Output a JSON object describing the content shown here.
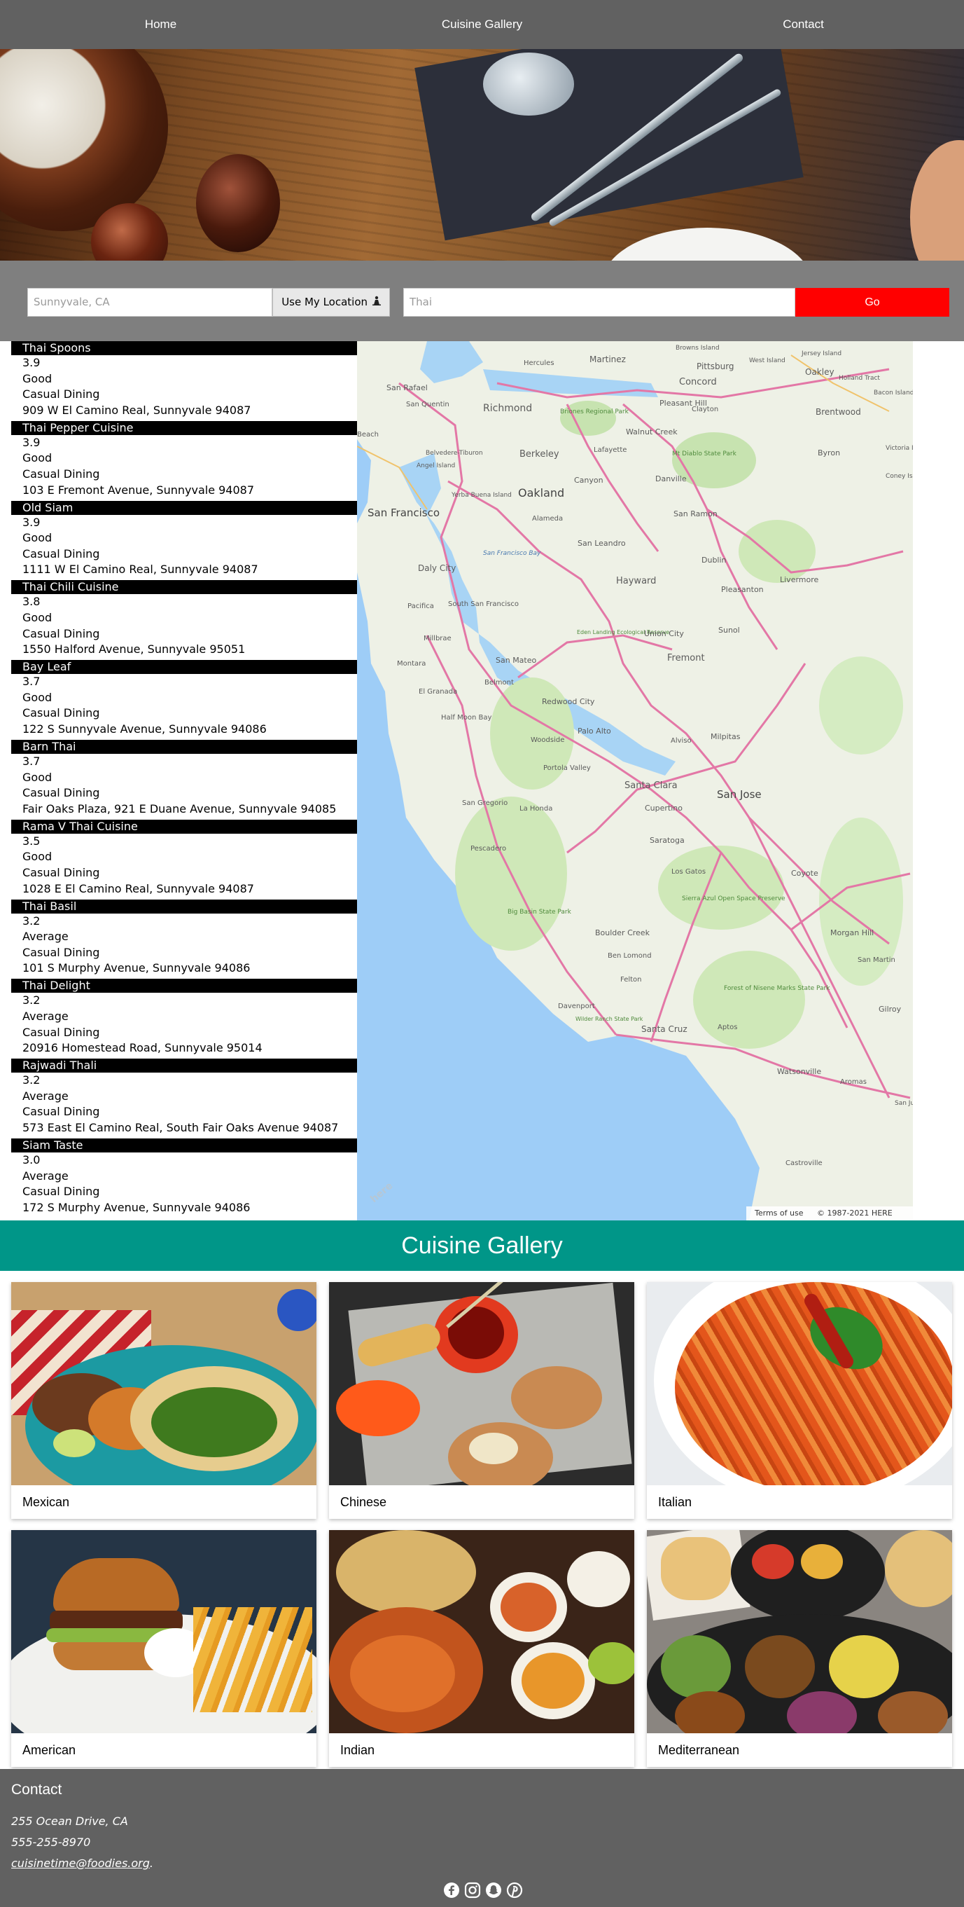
{
  "nav": {
    "items": [
      "Home",
      "Cuisine Gallery",
      "Contact"
    ]
  },
  "search": {
    "location_placeholder": "Sunnyvale, CA",
    "use_location_label": "Use My Location",
    "term_placeholder": "Thai",
    "go_label": "Go"
  },
  "restaurants": [
    {
      "name": "Thai Spoons",
      "rating": "3.9",
      "rating_text": "Good",
      "category": "Casual Dining",
      "address": "909 W El Camino Real, Sunnyvale 94087"
    },
    {
      "name": "Thai Pepper Cuisine",
      "rating": "3.9",
      "rating_text": "Good",
      "category": "Casual Dining",
      "address": "103 E Fremont Avenue, Sunnyvale 94087"
    },
    {
      "name": "Old Siam",
      "rating": "3.9",
      "rating_text": "Good",
      "category": "Casual Dining",
      "address": "1111 W El Camino Real, Sunnyvale 94087"
    },
    {
      "name": "Thai Chili Cuisine",
      "rating": "3.8",
      "rating_text": "Good",
      "category": "Casual Dining",
      "address": "1550 Halford Avenue, Sunnyvale 95051"
    },
    {
      "name": "Bay Leaf",
      "rating": "3.7",
      "rating_text": "Good",
      "category": "Casual Dining",
      "address": "122 S Sunnyvale Avenue, Sunnyvale 94086"
    },
    {
      "name": "Barn Thai",
      "rating": "3.7",
      "rating_text": "Good",
      "category": "Casual Dining",
      "address": "Fair Oaks Plaza, 921 E Duane Avenue, Sunnyvale 94085"
    },
    {
      "name": "Rama V Thai Cuisine",
      "rating": "3.5",
      "rating_text": "Good",
      "category": "Casual Dining",
      "address": "1028 E El Camino Real, Sunnyvale 94087"
    },
    {
      "name": "Thai Basil",
      "rating": "3.2",
      "rating_text": "Average",
      "category": "Casual Dining",
      "address": "101 S Murphy Avenue, Sunnyvale 94086"
    },
    {
      "name": "Thai Delight",
      "rating": "3.2",
      "rating_text": "Average",
      "category": "Casual Dining",
      "address": "20916 Homestead Road, Sunnyvale 95014"
    },
    {
      "name": "Rajwadi Thali",
      "rating": "3.2",
      "rating_text": "Average",
      "category": "Casual Dining",
      "address": "573 East El Camino Real, South Fair Oaks Avenue 94087"
    },
    {
      "name": "Siam Taste",
      "rating": "3.0",
      "rating_text": "Average",
      "category": "Casual Dining",
      "address": "172 S Murphy Avenue, Sunnyvale 94086"
    }
  ],
  "map": {
    "labels": [
      "Browns Island",
      "Hercules",
      "Martinez",
      "Pittsburg",
      "West Island",
      "Jersey Island",
      "Oakley",
      "San Rafael",
      "San Quentin",
      "Richmond",
      "Concord",
      "Holland Tract",
      "Bacon Island",
      "Briones Regional Park",
      "Pleasant Hill",
      "Clayton",
      "Brentwood",
      "Walnut Creek",
      "Lafayette",
      "Mt Diablo State Park",
      "Byron",
      "Belvedere-Tiburon",
      "Berkeley",
      "Victoria Island",
      "Angel Island",
      "Canyon",
      "Danville",
      "Yerba Buena Island",
      "Oakland",
      "Coney Island",
      "San Francisco",
      "Alameda",
      "San Ramon",
      "San Francisco Bay",
      "San Leandro",
      "Dublin",
      "Daly City",
      "Hayward",
      "Pleasanton",
      "Livermore",
      "Pacifica",
      "South San Francisco",
      "Eden Landing Ecological Reserve",
      "Union City",
      "Sunol",
      "Millbrae",
      "San Mateo",
      "Fremont",
      "Montara",
      "Belmont",
      "El Granada",
      "Redwood City",
      "Half Moon Bay",
      "Palo Alto",
      "Alviso",
      "Milpitas",
      "Woodside",
      "Portola Valley",
      "Santa Clara",
      "San Jose",
      "San Gregorio",
      "La Honda",
      "Cupertino",
      "Pescadero",
      "Saratoga",
      "Coyote",
      "Los Gatos",
      "Sierra Azul Open Space Preserve",
      "Big Basin State Park",
      "Morgan Hill",
      "Boulder Creek",
      "Ben Lomond",
      "San Martin",
      "Felton",
      "Forest of Nisene Marks State Park",
      "Davenport",
      "Wilder Ranch State Park",
      "Gilroy",
      "Santa Cruz",
      "Aptos",
      "Watsonville",
      "Aromas",
      "San Juan Bautista",
      "Castroville",
      "Beach"
    ],
    "terms": "Terms of use",
    "copyright": "© 1987-2021 HERE",
    "logo": "here"
  },
  "gallery": {
    "title": "Cuisine Gallery",
    "cards": [
      "Mexican",
      "Chinese",
      "Italian",
      "American",
      "Indian",
      "Mediterranean"
    ]
  },
  "contact": {
    "title": "Contact",
    "address": "255 Ocean Drive, CA",
    "phone": "555-255-8970",
    "email": "cuisinetime@foodies.org",
    "email_suffix": "."
  },
  "icons": {
    "location": "person-pin-icon",
    "social": [
      "facebook-icon",
      "instagram-icon",
      "snapchat-icon",
      "pinterest-icon"
    ]
  },
  "colors": {
    "nav": "#616161",
    "search_bar": "#7f7f7f",
    "go_button": "#ff0000",
    "gallery_header": "#009688",
    "contact": "#616161"
  }
}
